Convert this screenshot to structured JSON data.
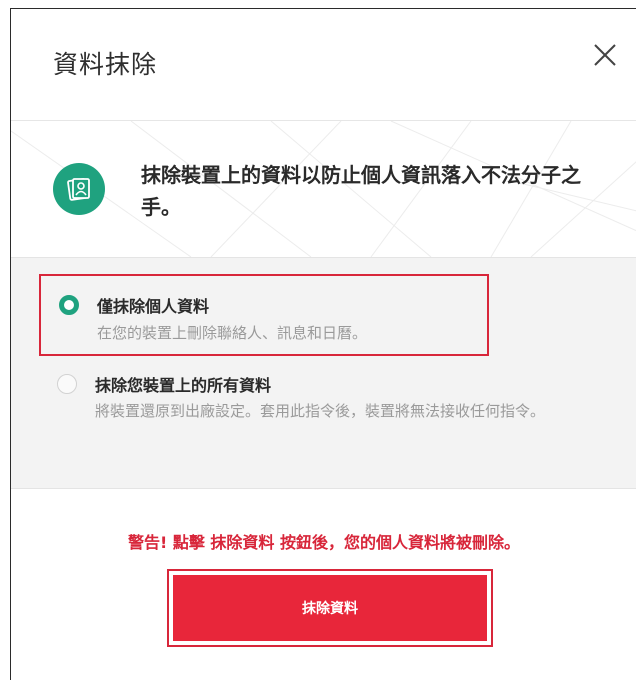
{
  "dialog": {
    "title": "資料抹除",
    "close_icon": "close-icon",
    "banner": {
      "icon": "photo-contacts-icon",
      "text": "抹除裝置上的資料以防止個人資訊落入不法分子之手。"
    },
    "options": [
      {
        "title": "僅抹除個人資料",
        "description": "在您的裝置上刪除聯絡人、訊息和日曆。",
        "selected": true
      },
      {
        "title": "抹除您裝置上的所有資料",
        "description": "將裝置還原到出廠設定。套用此指令後，裝置將無法接收任何指令。",
        "selected": false
      }
    ],
    "warning": "警告! 點擊 抹除資料 按鈕後，您的個人資料將被刪除。",
    "wipe_button_label": "抹除資料"
  },
  "colors": {
    "accent_green": "#1fa27f",
    "danger_red": "#e8263a",
    "highlight_border": "#d8263a"
  }
}
